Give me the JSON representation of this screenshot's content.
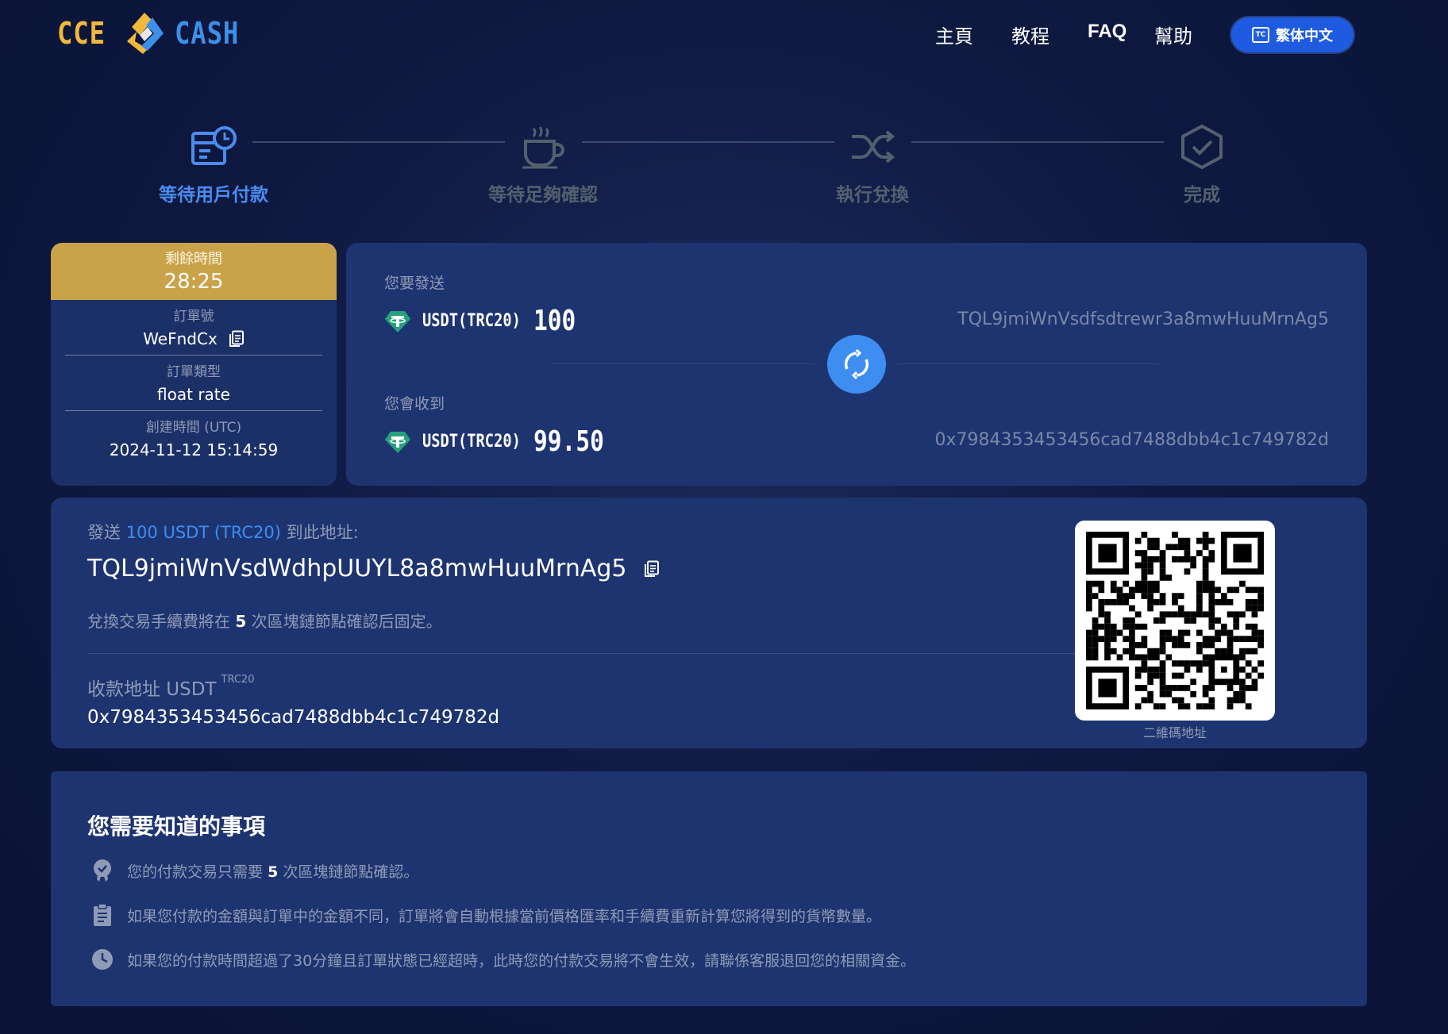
{
  "brand": {
    "left": "CCE",
    "right": "CASH"
  },
  "nav": {
    "home": "主頁",
    "tutorial": "教程",
    "faq": "FAQ",
    "help": "幫助",
    "lang": "繁体中文",
    "lang_icon": "TC"
  },
  "steps": [
    {
      "label": "等待用戶付款",
      "icon": "calendar-clock-icon",
      "active": true
    },
    {
      "label": "等待足夠確認",
      "icon": "coffee-cup-icon",
      "active": false
    },
    {
      "label": "執行兌換",
      "icon": "shuffle-icon",
      "active": false
    },
    {
      "label": "完成",
      "icon": "shield-check-icon",
      "active": false
    }
  ],
  "order": {
    "time_left_label": "剩餘時間",
    "time_left": "28:25",
    "order_no_label": "訂單號",
    "order_no": "WeFndCx",
    "order_type_label": "訂單類型",
    "order_type": "float rate",
    "created_label": "創建時間 (UTC)",
    "created": "2024-11-12 15:14:59"
  },
  "exchange": {
    "send_label": "您要發送",
    "send_coin": "USDT(TRC20)",
    "send_amount": "100",
    "send_addr": "TQL9jmiWnVsdfsdtrewr3a8mwHuuMrnAg5",
    "recv_label": "您會收到",
    "recv_coin": "USDT(TRC20)",
    "recv_amount": "99.50",
    "recv_addr": "0x7984353453456cad7488dbb4c1c749782d"
  },
  "deposit": {
    "title_pre": "發送",
    "title_hl": "100 USDT (TRC20)",
    "title_post": "到此地址:",
    "address": "TQL9jmiWnVsdWdhpUUYL8a8mwHuuMrnAg5",
    "note_pre": "兌換交易手續費將在",
    "note_num": "5",
    "note_post": "次區塊鏈節點確認后固定。",
    "recv_label": "收款地址 USDT",
    "recv_sup": "TRC20",
    "recv_address": "0x7984353453456cad7488dbb4c1c749782d",
    "qr_caption": "二維碼地址"
  },
  "notes": {
    "title": "您需要知道的事項",
    "items": [
      {
        "icon": "badge-check-icon",
        "pre": "您的付款交易只需要",
        "num": "5",
        "post": "次區塊鏈節點確認。"
      },
      {
        "icon": "clipboard-icon",
        "text": "如果您付款的金額與訂單中的金額不同，訂單將會自動根據當前價格匯率和手續費重新計算您將得到的貨幣數量。"
      },
      {
        "icon": "clock-icon",
        "text": "如果您的付款時間超過了30分鐘且訂單狀態已經超時，此時您的付款交易將不會生效，請聯係客服退回您的相關資金。"
      }
    ]
  },
  "colors": {
    "accent": "#3d8ef0",
    "gold": "#c9a24a",
    "card": "#1e3470",
    "tether": "#26a17b"
  }
}
